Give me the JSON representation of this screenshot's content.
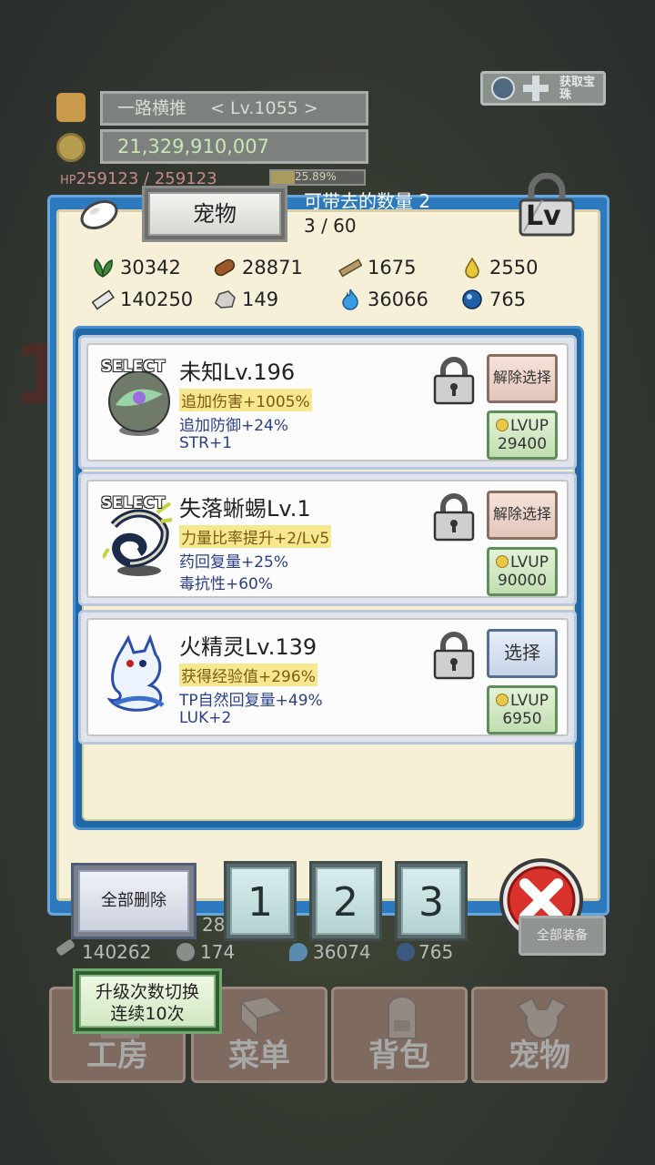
{
  "hud": {
    "player_name": "一路横推",
    "player_level": "< Lv.1055 >",
    "gold": "21,329,910,007",
    "hp_label": "HP",
    "hp_text": "259123 / 259123",
    "exp_percent_text": "25.89%",
    "exp_fraction": 0.2589,
    "get_button_text": "获取宝珠"
  },
  "panel": {
    "tab_label": "宠物",
    "carry_label": "可带去的数量 2",
    "carry_count": "3 / 60",
    "lock_badge": "Lv"
  },
  "resources": [
    {
      "icon": "herb-icon",
      "value": "30342"
    },
    {
      "icon": "wood-log-icon",
      "value": "28871"
    },
    {
      "icon": "plank-icon",
      "value": "1675"
    },
    {
      "icon": "oil-drop-icon",
      "value": "2550"
    },
    {
      "icon": "iron-ingot-icon",
      "value": "140250"
    },
    {
      "icon": "stone-icon",
      "value": "149"
    },
    {
      "icon": "blue-flame-icon",
      "value": "36066"
    },
    {
      "icon": "blue-orb-icon",
      "value": "765"
    }
  ],
  "pets": [
    {
      "select_tag": "SELECT",
      "name": "未知Lv.196",
      "stat1": "追加伤害+1005%",
      "stat2": "追加防御+24%",
      "stat3": "STR+1",
      "action": "解除选择",
      "lvup_label": "LVUP",
      "lvup_cost": "29400"
    },
    {
      "select_tag": "SELECT",
      "name": "失落蜥蜴Lv.1",
      "stat1": "力量比率提升+2/Lv5",
      "stat2": "药回复量+25%",
      "stat3": "毒抗性+60%",
      "action": "解除选择",
      "lvup_label": "LVUP",
      "lvup_cost": "90000"
    },
    {
      "select_tag": "",
      "name": "火精灵Lv.139",
      "stat1": "获得经验值+296%",
      "stat2": "TP自然回复量+49%",
      "stat3": "LUK+2",
      "action": "选择",
      "lvup_label": "LVUP",
      "lvup_cost": "6950"
    }
  ],
  "controls": {
    "delete_all": "全部删除",
    "slots": [
      "1",
      "2",
      "3"
    ]
  },
  "under_hud": {
    "partial_number": "28",
    "iron": "140262",
    "stone": "174",
    "flame": "36074",
    "orb": "765",
    "equip_button": "全部装备"
  },
  "toggle": {
    "line1": "升级次数切换",
    "line2": "连续10次"
  },
  "nav": [
    "工房",
    "菜单",
    "背包",
    "宠物"
  ],
  "colors": {
    "panel_blue": "#2d79bd",
    "panel_cream": "#f6f0d8",
    "stat_highlight": "#f7e890",
    "stat_text_blue": "#2b3f86",
    "close_red": "#d9322c"
  }
}
